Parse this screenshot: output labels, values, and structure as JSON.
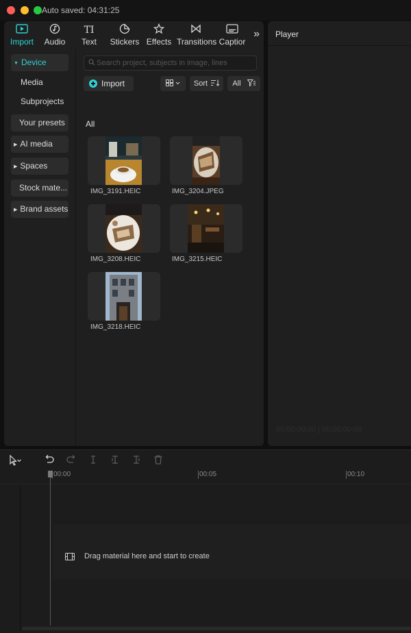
{
  "titlebar": {
    "autosave": "Auto saved: 04:31:25"
  },
  "toolbar": {
    "tabs": [
      {
        "label": "Import",
        "icon": "import-icon"
      },
      {
        "label": "Audio",
        "icon": "audio-icon"
      },
      {
        "label": "Text",
        "icon": "text-icon"
      },
      {
        "label": "Stickers",
        "icon": "stickers-icon"
      },
      {
        "label": "Effects",
        "icon": "effects-icon"
      },
      {
        "label": "Transitions",
        "icon": "transitions-icon"
      },
      {
        "label": "Captior",
        "icon": "captions-icon"
      }
    ],
    "text_glyph": "TI",
    "more_glyph": "»"
  },
  "sidebar": {
    "items": [
      {
        "label": "Device"
      },
      {
        "label": "Media"
      },
      {
        "label": "Subprojects"
      },
      {
        "label": "Your presets"
      },
      {
        "label": "AI media"
      },
      {
        "label": "Spaces"
      },
      {
        "label": "Stock mate..."
      },
      {
        "label": "Brand assets"
      }
    ]
  },
  "media": {
    "search_placeholder": "Search project, subjects in image, lines",
    "import_label": "Import",
    "sort_label": "Sort",
    "filter_label": "All",
    "folder_label": "All",
    "files": [
      {
        "name": "IMG_3191.HEIC"
      },
      {
        "name": "IMG_3204.JPEG"
      },
      {
        "name": "IMG_3208.HEIC"
      },
      {
        "name": "IMG_3215.HEIC"
      },
      {
        "name": "IMG_3218.HEIC"
      }
    ]
  },
  "player": {
    "title": "Player",
    "time": "00:00:00:00 | 00:00:00:00"
  },
  "timeline": {
    "ticks": [
      "00:00",
      "00:05",
      "00:10"
    ],
    "drag_message": "Drag material here and start to create"
  },
  "colors": {
    "accent": "#2fd2d6",
    "panel": "#1f1f1f",
    "background": "#0f0f0f"
  }
}
